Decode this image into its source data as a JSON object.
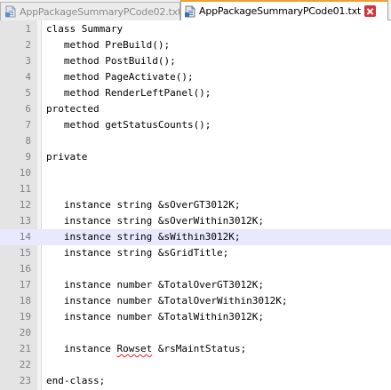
{
  "tabs": [
    {
      "label": "AppPackageSummaryPCode02.txt",
      "active": false
    },
    {
      "label": "AppPackageSummaryPCode01.txt",
      "active": true
    }
  ],
  "editor": {
    "current_line": 14,
    "lines": [
      {
        "n": "1",
        "text": "class Summary"
      },
      {
        "n": "2",
        "text": "   method PreBuild();"
      },
      {
        "n": "3",
        "text": "   method PostBuild();"
      },
      {
        "n": "4",
        "text": "   method PageActivate();"
      },
      {
        "n": "5",
        "text": "   method RenderLeftPanel();"
      },
      {
        "n": "6",
        "text": "protected"
      },
      {
        "n": "7",
        "text": "   method getStatusCounts();"
      },
      {
        "n": "8",
        "text": ""
      },
      {
        "n": "9",
        "text": "private"
      },
      {
        "n": "10",
        "text": ""
      },
      {
        "n": "11",
        "text": ""
      },
      {
        "n": "12",
        "text": "   instance string &sOverGT3012K;"
      },
      {
        "n": "13",
        "text": "   instance string &sOverWithin3012K;"
      },
      {
        "n": "14",
        "text": "   instance string &sWithin3012K;"
      },
      {
        "n": "15",
        "text": "   instance string &sGridTitle;"
      },
      {
        "n": "16",
        "text": ""
      },
      {
        "n": "17",
        "text": "   instance number &TotalOverGT3012K;"
      },
      {
        "n": "18",
        "text": "   instance number &TotalOverWithin3012K;"
      },
      {
        "n": "19",
        "text": "   instance number &TotalWithin3012K;"
      },
      {
        "n": "20",
        "text": ""
      },
      {
        "n": "21",
        "text_pre": "   instance ",
        "text_flag": "Rowset",
        "text_post": " &rsMaintStatus;"
      },
      {
        "n": "22",
        "text": ""
      },
      {
        "n": "23",
        "text": "end-class;"
      }
    ]
  },
  "colors": {
    "active_tab_accent": "#f0a030",
    "current_line_highlight": "#e8e8ff",
    "close_button": "#d0363b",
    "spellcheck_underline": "#e02020"
  },
  "icons": [
    "file-icon",
    "file-icon",
    "close-icon"
  ]
}
